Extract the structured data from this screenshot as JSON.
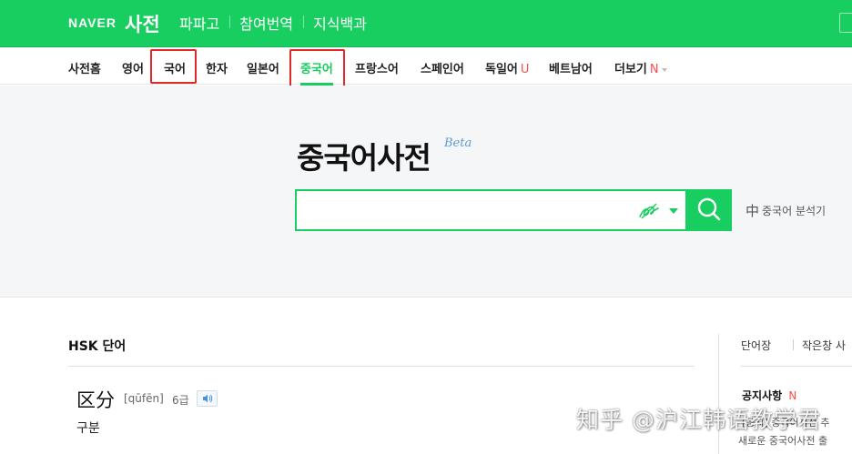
{
  "header": {
    "logo": "NAVER",
    "service": "사전",
    "links": [
      "파파고",
      "참여번역",
      "지식백과"
    ]
  },
  "langnav": {
    "items": [
      "사전홈",
      "영어",
      "국어",
      "한자",
      "일본어",
      "중국어",
      "프랑스어",
      "스페인어",
      "독일어",
      "베트남어",
      "더보기"
    ],
    "active": "중국어",
    "new_badge": "U",
    "more_badge": "N"
  },
  "search": {
    "title": "중국어사전",
    "beta": "Beta",
    "input_value": "",
    "analyzer_zh": "中",
    "analyzer_label": "중국어 분석기"
  },
  "hsk": {
    "title": "HSK 단어",
    "word": "区分",
    "pinyin": "[qūfēn]",
    "level": "6급",
    "meaning": "구분"
  },
  "sidebar": {
    "wordbook": "단어장",
    "minimode": "작은창 사",
    "notice_title": "공지사항",
    "notice_badge": "N",
    "notice_1": "[공지] 중국어사전 추",
    "notice_2": "새로운 중국어사전 출"
  },
  "watermark": "知乎 @沪江韩语教学君",
  "colors": {
    "brand_green": "#19ce60",
    "highlight_red": "#e02a2a",
    "badge_red": "#ff4b4b"
  }
}
